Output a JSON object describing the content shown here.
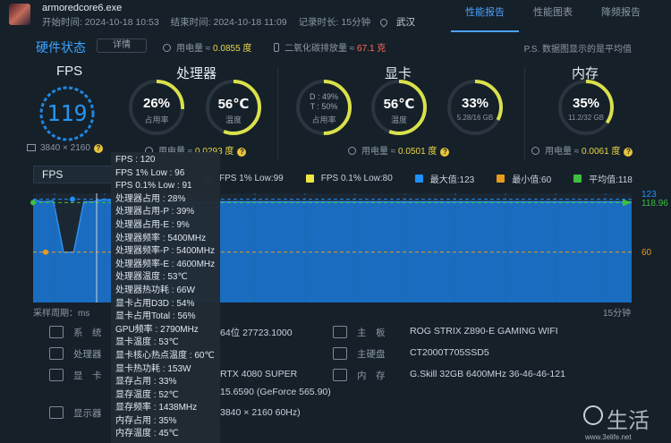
{
  "header": {
    "app_name": "armoredcore6.exe",
    "start_time": "开始时间: 2024-10-18 10:53",
    "end_time": "结束时间: 2024-10-18 11:09",
    "duration": "记录时长: 15分钟",
    "location": "武汉"
  },
  "tabs": [
    {
      "label": "性能报告",
      "active": true
    },
    {
      "label": "性能图表",
      "active": false
    },
    {
      "label": "降频报告",
      "active": false
    }
  ],
  "summary": {
    "title": "硬件状态",
    "detail_button": "详情",
    "power_label": "用电量 ≈ ",
    "power_value": "0.0855 度",
    "co2_label": "二氧化碳排放量 ≈ ",
    "co2_value": "67.1 克",
    "note": "P.S. 数据图显示的是平均值"
  },
  "sections": {
    "fps": {
      "title": "FPS",
      "value": "119",
      "resolution": "3840 × 2160"
    },
    "cpu": {
      "title": "处理器",
      "usage_value": "26%",
      "usage_label": "占用率",
      "usage_fraction": 0.26,
      "temp_value": "56℃",
      "temp_label": "温度",
      "temp_fraction": 0.56,
      "power_label": "用电量 ≈ ",
      "power_value": "0.0293 度"
    },
    "gpu": {
      "title": "显卡",
      "d_value": "D : 49%",
      "t_value": "T : 50%",
      "usage_label": "占用率",
      "usage_fraction": 0.5,
      "temp_value": "56℃",
      "temp_label": "温度",
      "temp_fraction": 0.56,
      "mem_value": "33%",
      "mem_label": "5.28/16 GB",
      "mem_fraction": 0.33,
      "power_label": "用电量 ≈ ",
      "power_value": "0.0501 度"
    },
    "ram": {
      "title": "内存",
      "usage_value": "35%",
      "usage_label": "11.2/32 GB",
      "usage_fraction": 0.35,
      "power_label": "用电量 ≈ ",
      "power_value": "0.0061 度"
    }
  },
  "chart_select": "FPS",
  "legend": [
    {
      "label": "FPS 1% Low:99",
      "color": "#2f4f4f"
    },
    {
      "label": "FPS 0.1% Low:80",
      "color": "#f0e442"
    },
    {
      "label": "最大值:123",
      "color": "#1e90ff"
    },
    {
      "label": "最小值:60",
      "color": "#e69b1f"
    },
    {
      "label": "平均值:118",
      "color": "#3fbf3f"
    }
  ],
  "chart_data": {
    "type": "area",
    "xlabel": "采样周期：ms",
    "x_end_label": "15分钟",
    "ylim": [
      0,
      130
    ],
    "values": [
      122,
      120,
      121,
      60,
      60,
      120,
      120,
      123,
      121,
      120,
      120,
      121,
      120,
      120,
      120,
      120,
      120,
      120,
      120,
      120,
      120,
      120,
      120,
      120,
      120,
      120,
      120,
      120,
      120,
      120,
      120,
      120,
      120,
      120,
      120,
      120,
      120,
      120,
      120,
      120,
      120,
      120,
      120,
      120,
      120,
      120,
      120,
      120,
      120,
      120,
      120,
      120,
      120,
      120,
      120,
      120,
      120,
      120,
      120,
      120
    ],
    "max": {
      "value": 123,
      "label": "123"
    },
    "min": {
      "value": 60,
      "label": "60"
    },
    "avg": {
      "value": 118.96,
      "label": "118.96"
    }
  },
  "specs": {
    "system_label": "系　统",
    "system_value": "64位 27723.1000",
    "cpu_label": "处理器",
    "cpu_value": "…",
    "gpu_label": "显　卡",
    "gpu_value": "RTX 4080 SUPER",
    "driver_value": "15.6590 (GeForce 565.90)",
    "monitor_label": "显示器",
    "monitor_value": "3840 × 2160 60Hz)",
    "board_label": "主　板",
    "board_value": "ROG STRIX Z890-E GAMING WIFI",
    "disk_label": "主硬盘",
    "disk_value": "CT2000T705SSD5",
    "memory_label": "内　存",
    "memory_value": "G.Skill 32GB 6400MHz 36-46-46-121"
  },
  "tooltip": [
    "FPS : 120",
    "FPS 1% Low : 96",
    "FPS 0.1% Low : 91",
    "处理器占用 : 28%",
    "处理器占用-P : 39%",
    "处理器占用-E : 9%",
    "处理器频率 : 5400MHz",
    "处理器频率-P : 5400MHz",
    "处理器频率-E : 4600MHz",
    "处理器温度 : 53℃",
    "处理器热功耗 : 66W",
    "显卡占用D3D : 54%",
    "显卡占用Total : 56%",
    "GPU频率 : 2790MHz",
    "显卡温度 : 53℃",
    "显卡核心热点温度 : 60℃",
    "显卡热功耗 : 153W",
    "显存占用 : 33%",
    "显存温度 : 52℃",
    "显存频率 : 1438MHz",
    "内存占用 : 35%",
    "内存温度 : 45℃"
  ],
  "watermark": {
    "text": "生活",
    "url": "www.3elife.net"
  }
}
